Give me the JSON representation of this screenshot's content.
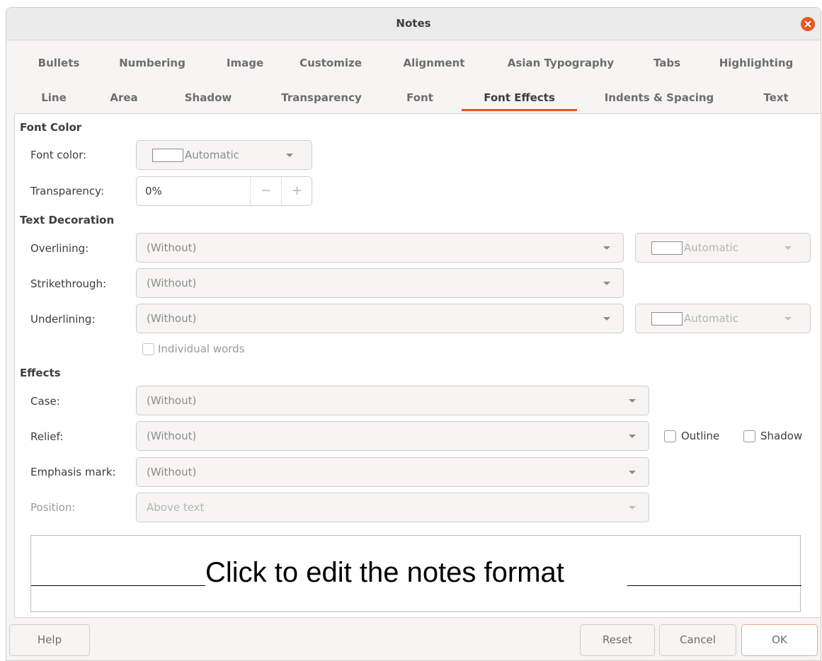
{
  "window": {
    "title": "Notes"
  },
  "tabs_row1": [
    "Bullets",
    "Numbering",
    "Image",
    "Customize",
    "Alignment",
    "Asian Typography",
    "Tabs",
    "Highlighting"
  ],
  "tabs_row2": [
    "Line",
    "Area",
    "Shadow",
    "Transparency",
    "Font",
    "Font Effects",
    "Indents & Spacing",
    "Text"
  ],
  "active_tab": "Font Effects",
  "font_color": {
    "section": "Font Color",
    "font_color_label": "Font color:",
    "font_color_value": "Automatic",
    "transparency_label": "Transparency:",
    "transparency_value": "0%",
    "minus": "−",
    "plus": "+"
  },
  "decoration": {
    "section": "Text Decoration",
    "overlining_label": "Overlining:",
    "overlining_value": "(Without)",
    "overlining_color": "Automatic",
    "strikethrough_label": "Strikethrough:",
    "strikethrough_value": "(Without)",
    "underlining_label": "Underlining:",
    "underlining_value": "(Without)",
    "underlining_color": "Automatic",
    "individual_words": "Individual words"
  },
  "effects": {
    "section": "Effects",
    "case_label": "Case:",
    "case_value": "(Without)",
    "relief_label": "Relief:",
    "relief_value": "(Without)",
    "outline": "Outline",
    "shadow": "Shadow",
    "emphasis_label": "Emphasis mark:",
    "emphasis_value": "(Without)",
    "position_label": "Position:",
    "position_value": "Above text"
  },
  "preview": {
    "text": "Click to edit the notes format"
  },
  "buttons": {
    "help": "Help",
    "reset": "Reset",
    "cancel": "Cancel",
    "ok": "OK"
  },
  "colors": {
    "accent": "#e95420",
    "background": "#f6f5f4"
  }
}
